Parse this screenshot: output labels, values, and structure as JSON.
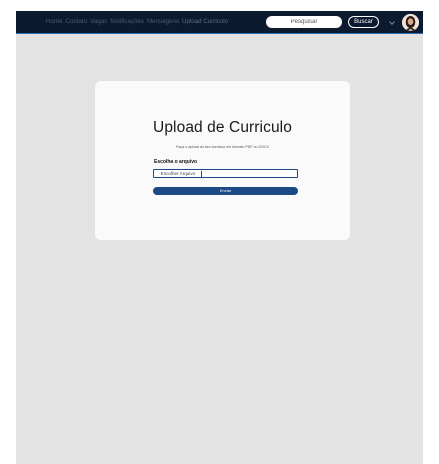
{
  "navbar": {
    "links": [
      {
        "label": "Home"
      },
      {
        "label": "Contato"
      },
      {
        "label": "Vagas"
      },
      {
        "label": "Notificações"
      },
      {
        "label": "Mensagens"
      },
      {
        "label": "Upload Curriculo"
      }
    ],
    "search_placeholder": "Pesquisar",
    "search_button": "Buscar",
    "avatar_icon": "user-avatar"
  },
  "upload": {
    "title": "Upload de Curriculo",
    "subtitle": "Faça o upload do seu curriculo em formato PDF ou DOCX",
    "field_label": "Escolha o arquivo",
    "choose_label": "Escolher Arquivo",
    "submit_label": "Enviar"
  },
  "colors": {
    "navbar_bg": "#0b1a2f",
    "accent": "#1c4a86",
    "page_bg": "#e3e3e3",
    "card_bg": "#fafafa"
  }
}
